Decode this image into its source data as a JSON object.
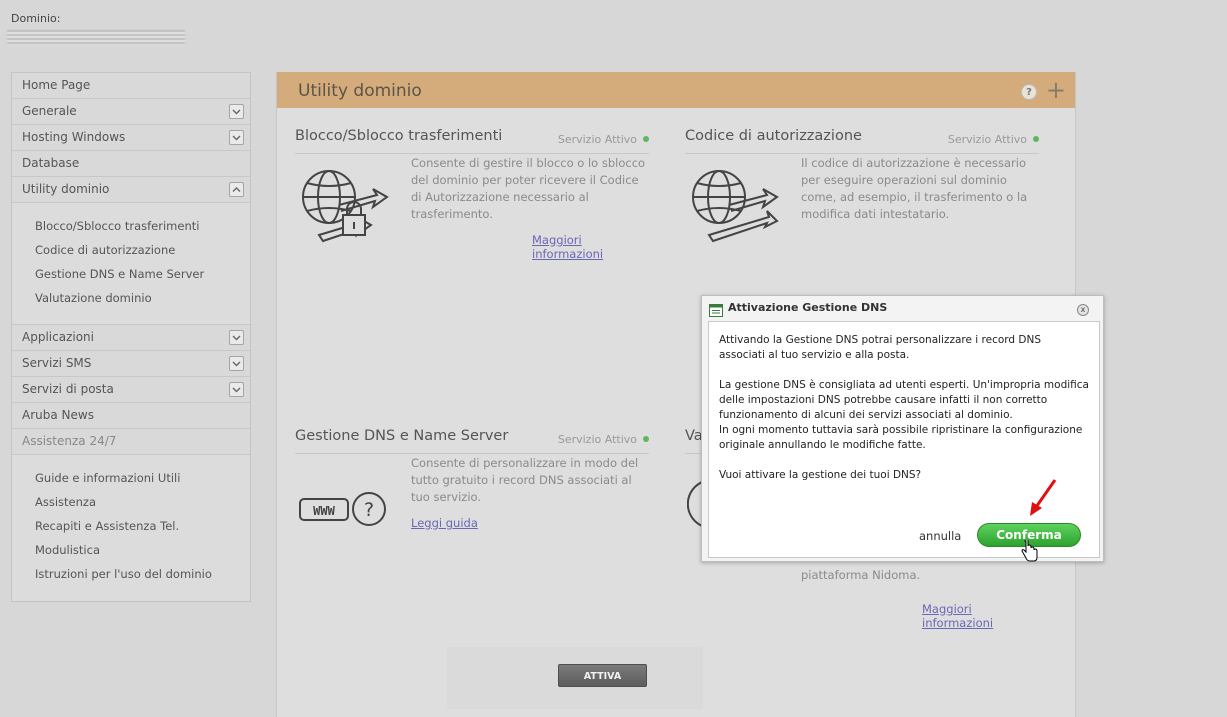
{
  "header": {
    "domain_label": "Dominio:"
  },
  "sidebar": {
    "items": [
      {
        "label": "Home Page",
        "chevron": ""
      },
      {
        "label": "Generale",
        "chevron": "down"
      },
      {
        "label": "Hosting Windows",
        "chevron": "down"
      },
      {
        "label": "Database",
        "chevron": ""
      },
      {
        "label": "Utility dominio",
        "chevron": "up"
      }
    ],
    "utility_sub": [
      "Blocco/Sblocco trasferimenti",
      "Codice di autorizzazione",
      "Gestione DNS e Name Server",
      "Valutazione dominio"
    ],
    "items2": [
      {
        "label": "Applicazioni",
        "chevron": "down"
      },
      {
        "label": "Servizi SMS",
        "chevron": "down"
      },
      {
        "label": "Servizi di posta",
        "chevron": "down"
      },
      {
        "label": "Aruba News",
        "chevron": ""
      },
      {
        "label": "Assistenza 24/7",
        "chevron": ""
      }
    ],
    "assistenza_sub": [
      "Guide e informazioni Utili",
      "Assistenza",
      "Recapiti e Assistenza Tel.",
      "Modulistica",
      "Istruzioni per l'uso del dominio"
    ]
  },
  "panel": {
    "title": "Utility dominio",
    "help_icon": "?",
    "plus_icon": "+",
    "cards": {
      "blocco": {
        "title": "Blocco/Sblocco trasferimenti",
        "status": "Servizio Attivo",
        "desc": "Consente di gestire il blocco o lo sblocco del dominio per poter ricevere il Codice di Autorizzazione necessario al trasferimento.",
        "link": "Maggiori informazioni"
      },
      "codice": {
        "title": "Codice di autorizzazione",
        "status": "Servizio Attivo",
        "desc": "Il codice di autorizzazione è necessario per eseguire operazioni sul dominio come, ad esempio, il trasferimento o la modifica dati intestatario."
      },
      "dns": {
        "title": "Gestione DNS e Name Server",
        "status": "Servizio Attivo",
        "desc": "Consente di personalizzare in modo del tutto gratuito i record DNS associati al tuo servizio.",
        "link": "Leggi guida",
        "icon_text": "WWW"
      },
      "valutazione": {
        "title_partial": "Va",
        "desc_partial": "piattaforma Nidoma.",
        "link": "Maggiori informazioni"
      }
    },
    "attiva_label": "ATTIVA"
  },
  "dialog": {
    "title": "Attivazione Gestione DNS",
    "close": "x",
    "para1": "Attivando la Gestione DNS potrai personalizzare i record DNS associati al tuo servizio e alla posta.",
    "para2a": "La gestione DNS è consigliata ad utenti esperti. Un'impropria modifica delle impostazioni DNS potrebbe causare infatti il non corretto funzionamento di alcuni dei servizi associati al dominio.",
    "para2b": "In ogni momento tuttavia sarà possibile ripristinare la configurazione originale annullando le modifiche fatte.",
    "para3": "Vuoi attivare la gestione dei tuoi DNS?",
    "cancel_label": "annulla",
    "confirm_label": "Conferma"
  },
  "colors": {
    "accent": "#d4ac7c",
    "confirm": "#3fb83f",
    "status_dot": "#5cb85c"
  }
}
